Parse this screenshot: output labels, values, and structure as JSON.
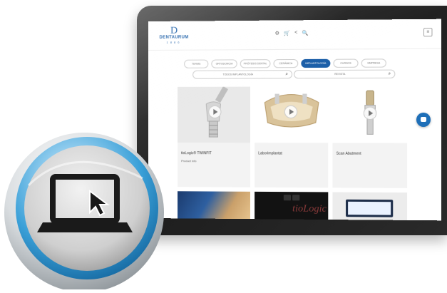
{
  "brand": {
    "mark": "D",
    "name": "DENTAURUM",
    "year": "1886"
  },
  "header_icons": [
    "⚙",
    "🛒",
    "<",
    "🔍"
  ],
  "menu_glyph": "≡",
  "tabs": [
    {
      "label": "TERMS"
    },
    {
      "label": "ORTODONCIA"
    },
    {
      "label": "PRÓTESIS DENTAL"
    },
    {
      "label": "CERÁMICA"
    },
    {
      "label": "IMPLANTOLOGÍA",
      "active": true
    },
    {
      "label": "CURSOS"
    },
    {
      "label": "EMPRESA"
    }
  ],
  "filters": {
    "category": "TODOS IMPLANTOLOGÍA",
    "type": "REVISTA",
    "search_icon": "search-icon"
  },
  "cards": [
    {
      "title": "tioLogic® TWINFIT",
      "subtitle": "Product info"
    },
    {
      "title": "Laborimplantat",
      "subtitle": ""
    },
    {
      "title": "Scan Abutment",
      "subtitle": ""
    }
  ],
  "video_cards": [
    {
      "overlay": "tioLogic"
    },
    {
      "overlay": ""
    },
    {
      "overlay": ""
    }
  ],
  "colors": {
    "accent": "#1c5fa8",
    "chat": "#1e6fb8",
    "badge_ring": "#3aa0d8"
  }
}
